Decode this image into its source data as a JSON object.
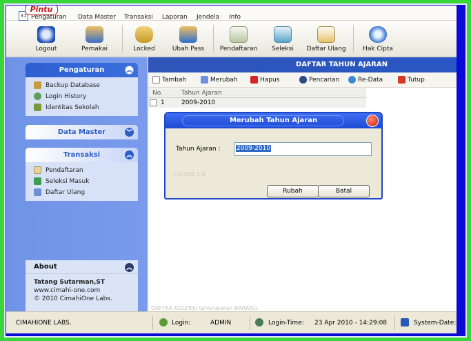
{
  "app": {
    "logo": "Pintu"
  },
  "menu": [
    "Pengaturan",
    "Data Master",
    "Transaksi",
    "Laporan",
    "Jendela",
    "Info"
  ],
  "toolbar": [
    "Logout",
    "Pemakai",
    "Locked",
    "Ubah Pass",
    "Pendaftaran",
    "Seleksi",
    "Daftar Ulang",
    "Hak Cipta"
  ],
  "sidebar": {
    "pengaturan": {
      "title": "Pengaturan",
      "items": [
        "Backup Database",
        "Login History",
        "Identitas Sekolah"
      ]
    },
    "data_master": {
      "title": "Data Master"
    },
    "transaksi": {
      "title": "Transaksi",
      "items": [
        "Pendaftaran",
        "Seleksi Masuk",
        "Daftar Ulang"
      ]
    },
    "about": {
      "title": "About",
      "name": "Tatang Sutarman,ST",
      "url": "www.cimahi-one.com",
      "copy": "© 2010 CimahiOne Labs."
    }
  },
  "content": {
    "title": "DAFTAR TAHUN AJARAN",
    "actions": [
      "Tambah",
      "Merubah",
      "Hapus",
      "Pencarian",
      "Re-Data",
      "Tutup"
    ],
    "columns": [
      "No.",
      "Tahun Ajaran"
    ],
    "rows": [
      {
        "no": "1",
        "tahun": "2009-2010"
      }
    ],
    "footer": "DAFTAR KOLEKSI tahunajaran BARANG"
  },
  "dialog": {
    "title": "Merubah Tahun Ajaran",
    "label": "Tahun Ajaran :",
    "value": "2009-2010",
    "watermark": "CO-PSB 2.0",
    "ok": "Rubah",
    "cancel": "Batal"
  },
  "status": {
    "company": "CIMAHIONE LABS.",
    "login_label": "Login:",
    "login_value": "ADMIN",
    "time_label": "Login-Time:",
    "time_value": "23 Apr 2010 - 14:29:08",
    "date_label": "System-Date:"
  },
  "colors": {
    "accent": "#2d5fd0",
    "frame": "#0b0bd8",
    "background": "#39d639"
  }
}
